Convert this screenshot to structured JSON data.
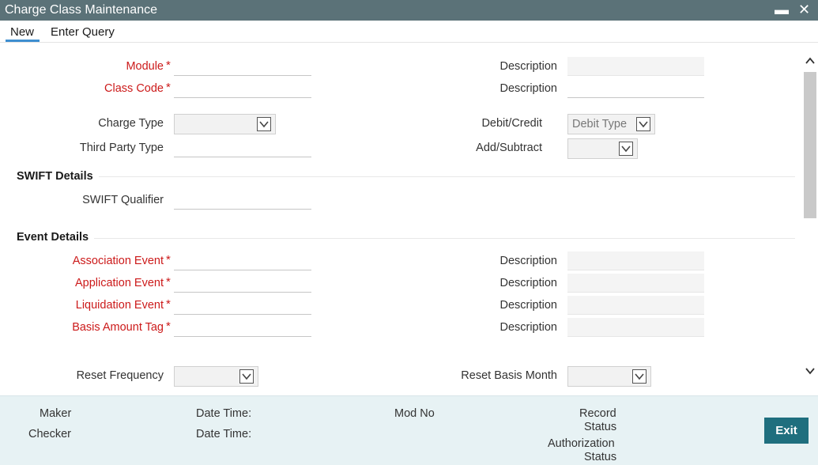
{
  "window": {
    "title": "Charge Class Maintenance",
    "minimize": "▬",
    "close": "✕"
  },
  "menu": {
    "new": "New",
    "enter_query": "Enter Query"
  },
  "fields": {
    "module": "Module",
    "class_code": "Class Code",
    "description": "Description",
    "charge_type": "Charge Type",
    "third_party_type": "Third Party Type",
    "debit_credit": "Debit/Credit",
    "debit_credit_value": "Debit Type",
    "add_subtract": "Add/Subtract",
    "required_mark": "*"
  },
  "swift": {
    "heading": "SWIFT Details",
    "qualifier": "SWIFT Qualifier"
  },
  "events": {
    "heading": "Event Details",
    "association_event": "Association Event",
    "application_event": "Application Event",
    "liquidation_event": "Liquidation Event",
    "basis_amount_tag": "Basis Amount Tag",
    "reset_frequency": "Reset Frequency",
    "reset_basis_month": "Reset Basis Month"
  },
  "footer": {
    "maker": "Maker",
    "checker": "Checker",
    "date_time": "Date Time:",
    "mod_no": "Mod No",
    "record": "Record",
    "authorization": "Authorization",
    "status": "Status",
    "exit": "Exit"
  },
  "icons": {
    "dropdown": "chevron-down-icon",
    "scroll_up": "chevron-up-icon",
    "scroll_down": "chevron-down-icon"
  },
  "colors": {
    "titlebar": "#5b7278",
    "required": "#cc1a1a",
    "footer": "#e7f2f4",
    "exit_button": "#1f6f7e",
    "active_tab": "#3e8fd0"
  }
}
